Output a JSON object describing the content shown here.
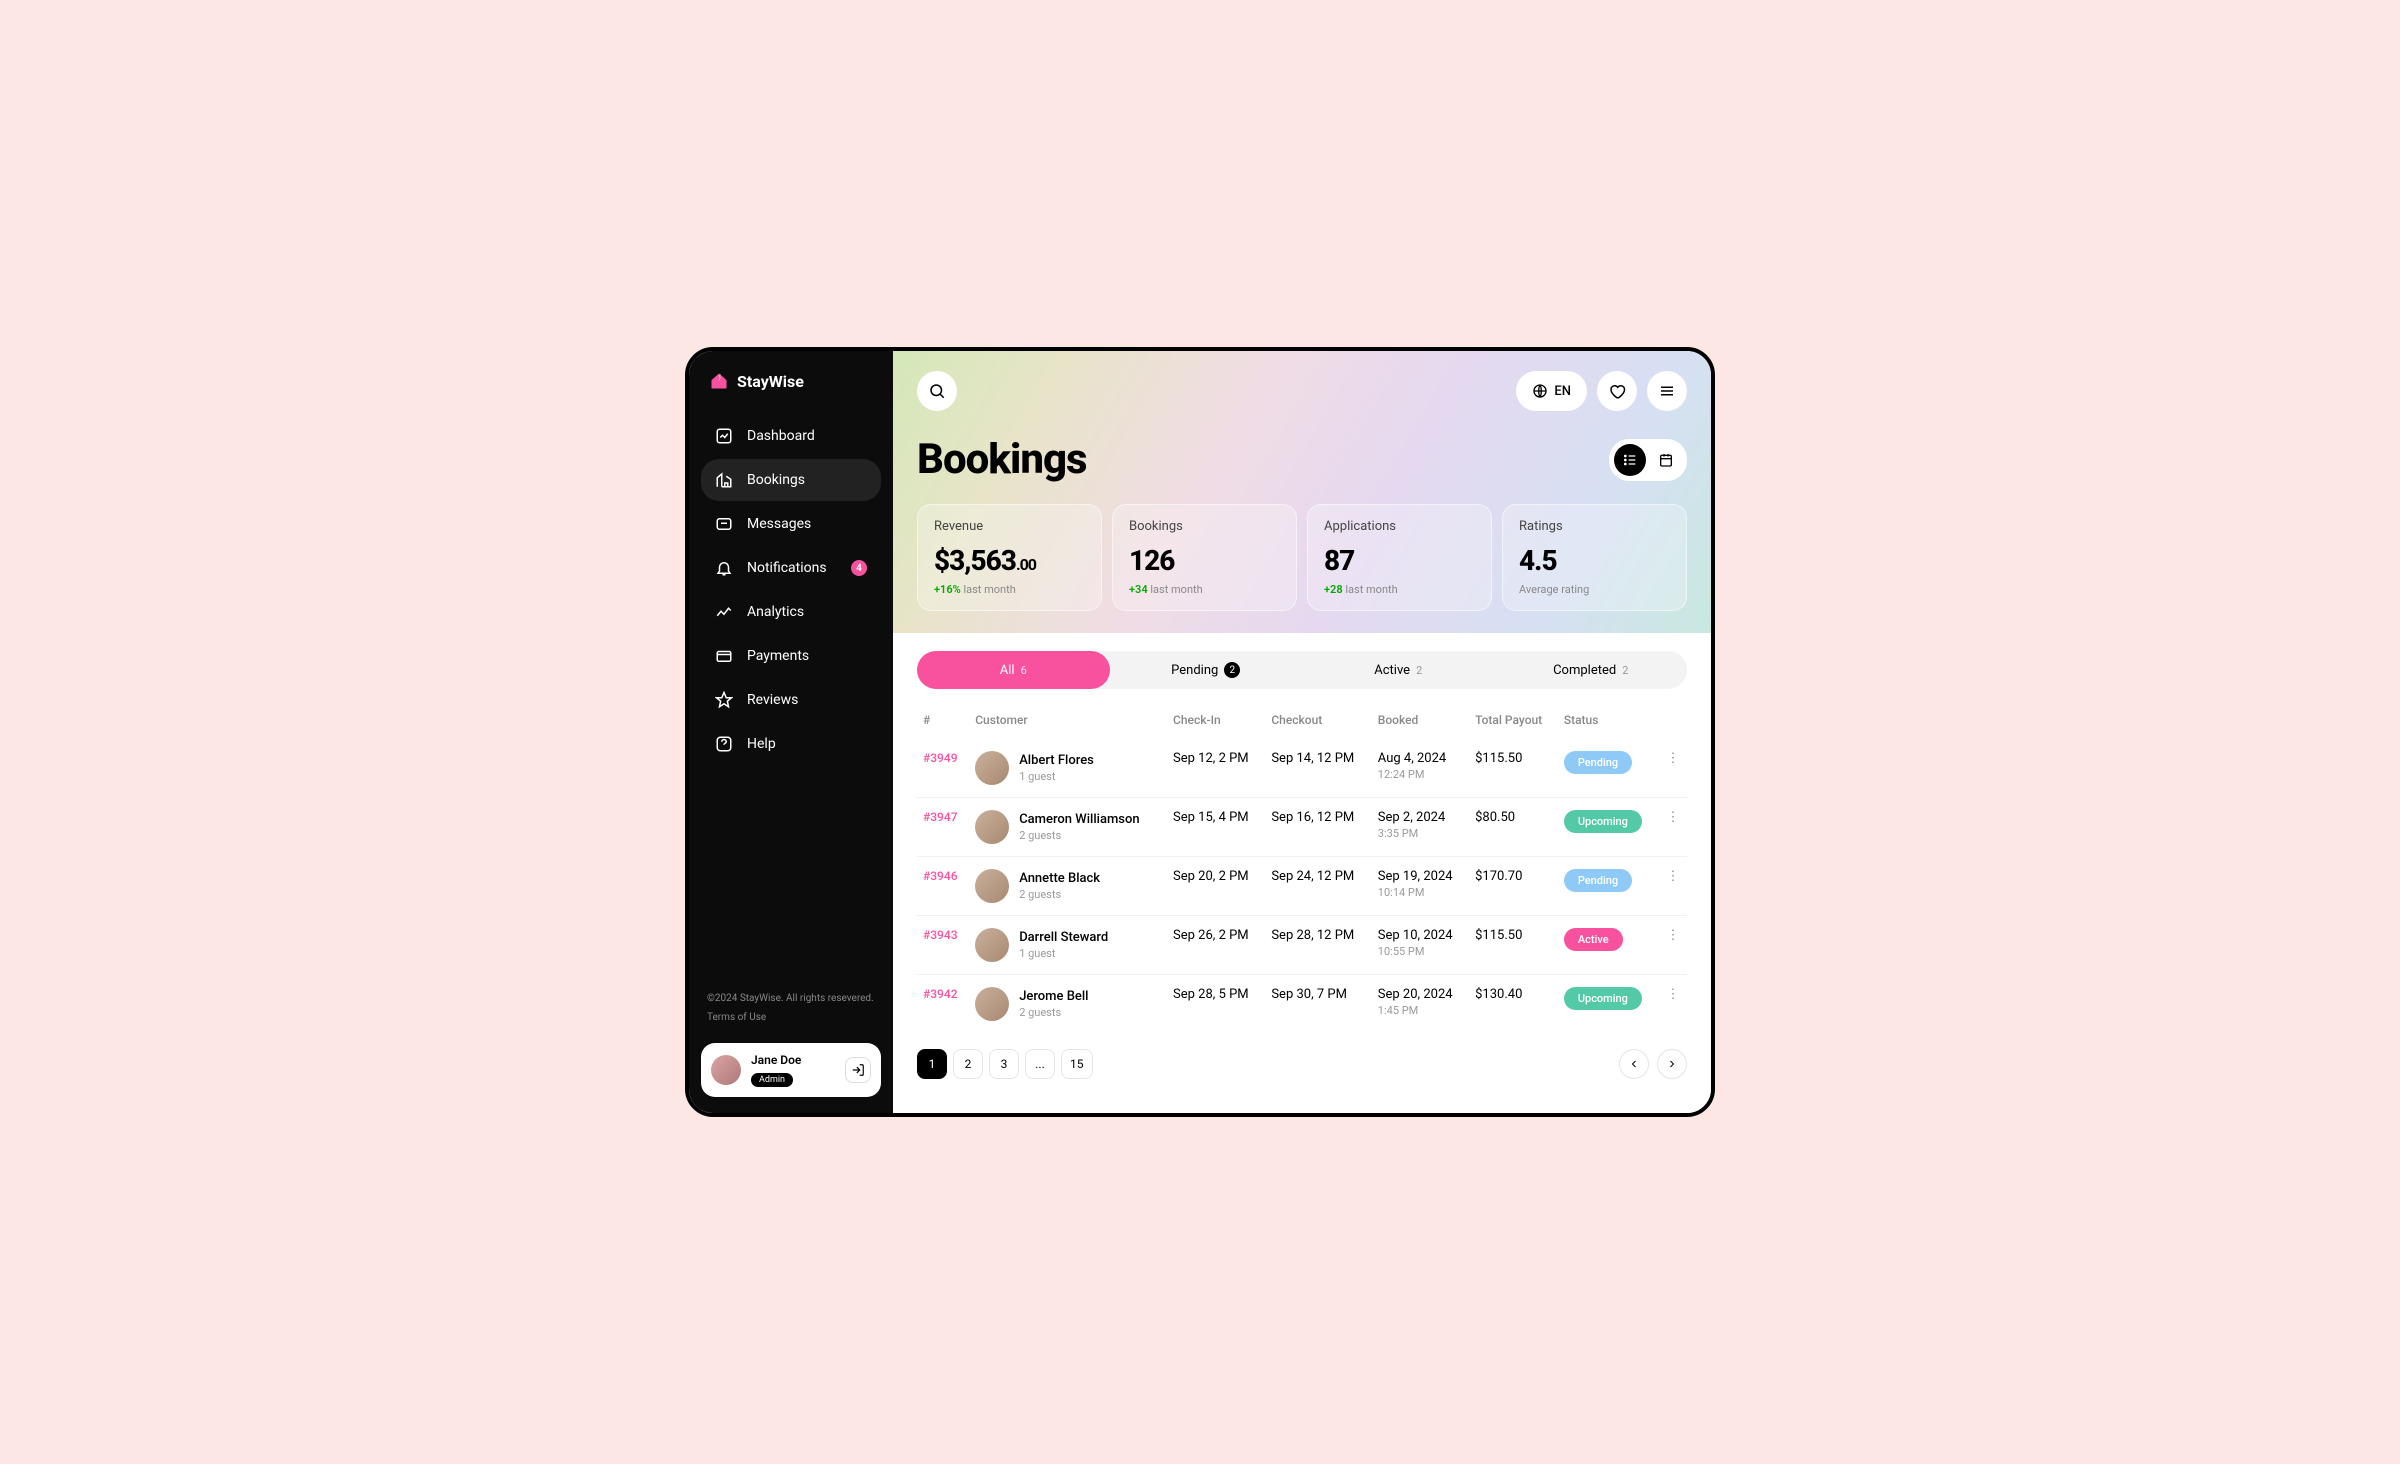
{
  "brand": "StayWise",
  "sidebar": {
    "items": [
      {
        "label": "Dashboard"
      },
      {
        "label": "Bookings"
      },
      {
        "label": "Messages"
      },
      {
        "label": "Notifications",
        "badge": "4"
      },
      {
        "label": "Analytics"
      },
      {
        "label": "Payments"
      },
      {
        "label": "Reviews"
      },
      {
        "label": "Help"
      }
    ],
    "copyright": "©2024 StayWise. All rights resevered.",
    "terms": "Terms of Use"
  },
  "user": {
    "name": "Jane Doe",
    "role": "Admin"
  },
  "header": {
    "lang": "EN"
  },
  "page_title": "Bookings",
  "stats": [
    {
      "label": "Revenue",
      "value": "$3,563",
      "cents": ".00",
      "delta": "+16%",
      "delta_suffix": "last month"
    },
    {
      "label": "Bookings",
      "value": "126",
      "delta": "+34",
      "delta_suffix": "last month"
    },
    {
      "label": "Applications",
      "value": "87",
      "delta": "+28",
      "delta_suffix": "last month"
    },
    {
      "label": "Ratings",
      "value": "4.5",
      "delta_suffix": "Average rating"
    }
  ],
  "tabs": [
    {
      "label": "All",
      "count": "6"
    },
    {
      "label": "Pending",
      "count": "2",
      "badge": true
    },
    {
      "label": "Active",
      "count": "2"
    },
    {
      "label": "Completed",
      "count": "2"
    }
  ],
  "columns": [
    "#",
    "Customer",
    "Check-In",
    "Checkout",
    "Booked",
    "Total Payout",
    "Status"
  ],
  "rows": [
    {
      "id": "#3949",
      "name": "Albert Flores",
      "guests": "1 guest",
      "checkin": "Sep 12, 2 PM",
      "checkout": "Sep 14, 12 PM",
      "booked": "Aug 4, 2024",
      "booked_time": "12:24 PM",
      "payout": "$115.50",
      "status": "Pending",
      "status_class": "status-pending"
    },
    {
      "id": "#3947",
      "name": "Cameron Williamson",
      "guests": "2 guests",
      "checkin": "Sep 15, 4 PM",
      "checkout": "Sep 16, 12 PM",
      "booked": "Sep 2, 2024",
      "booked_time": "3:35 PM",
      "payout": "$80.50",
      "status": "Upcoming",
      "status_class": "status-upcoming"
    },
    {
      "id": "#3946",
      "name": "Annette Black",
      "guests": "2 guests",
      "checkin": "Sep 20, 2 PM",
      "checkout": "Sep 24, 12 PM",
      "booked": "Sep 19, 2024",
      "booked_time": "10:14 PM",
      "payout": "$170.70",
      "status": "Pending",
      "status_class": "status-pending"
    },
    {
      "id": "#3943",
      "name": "Darrell Steward",
      "guests": "1 guest",
      "checkin": "Sep 26, 2 PM",
      "checkout": "Sep 28, 12 PM",
      "booked": "Sep 10, 2024",
      "booked_time": "10:55 PM",
      "payout": "$115.50",
      "status": "Active",
      "status_class": "status-active"
    },
    {
      "id": "#3942",
      "name": "Jerome Bell",
      "guests": "2 guests",
      "checkin": "Sep 28, 5 PM",
      "checkout": "Sep 30, 7 PM",
      "booked": "Sep 20, 2024",
      "booked_time": "1:45 PM",
      "payout": "$130.40",
      "status": "Upcoming",
      "status_class": "status-upcoming"
    }
  ],
  "pagination": {
    "pages": [
      "1",
      "2",
      "3",
      "...",
      "15"
    ]
  }
}
